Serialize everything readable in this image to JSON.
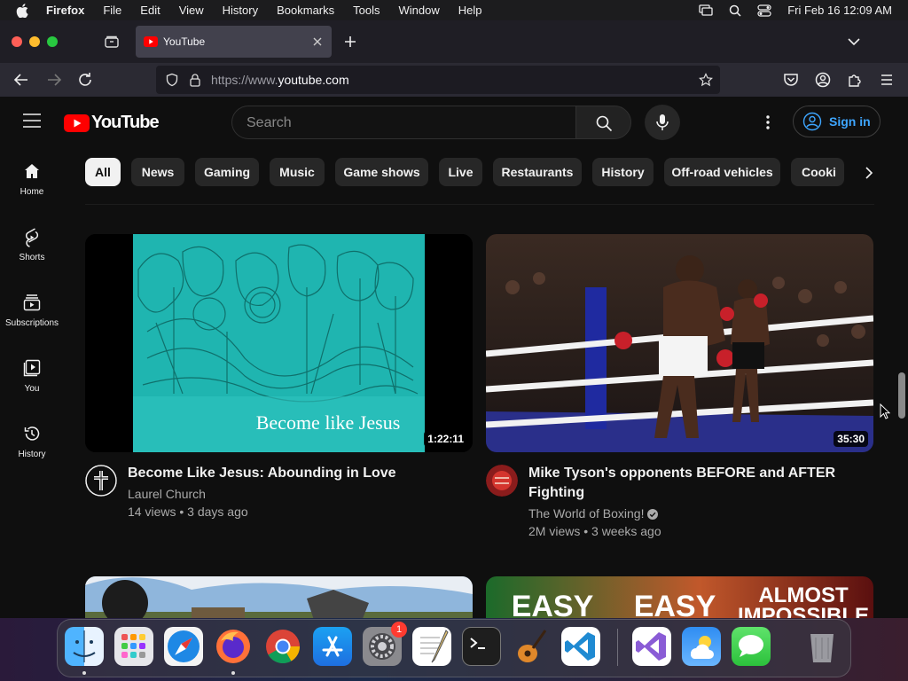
{
  "menubar": {
    "app_name": "Firefox",
    "menus": [
      "File",
      "Edit",
      "View",
      "History",
      "Bookmarks",
      "Tools",
      "Window",
      "Help"
    ],
    "clock": "Fri Feb 16  12:09 AM"
  },
  "browser": {
    "tab_title": "YouTube",
    "url_scheme": "https://www.",
    "url_host": "youtube.com"
  },
  "youtube": {
    "logo_text": "YouTube",
    "search_placeholder": "Search",
    "signin_label": "Sign in",
    "chips": [
      "All",
      "News",
      "Gaming",
      "Music",
      "Game shows",
      "Live",
      "Restaurants",
      "History",
      "Off-road vehicles",
      "Cooki"
    ],
    "active_chip": "All",
    "sidebar": [
      {
        "label": "Home",
        "icon": "home-icon"
      },
      {
        "label": "Shorts",
        "icon": "shorts-icon"
      },
      {
        "label": "Subscriptions",
        "icon": "subscriptions-icon"
      },
      {
        "label": "You",
        "icon": "you-icon"
      },
      {
        "label": "History",
        "icon": "history-icon"
      }
    ],
    "videos": [
      {
        "title": "Become Like Jesus: Abounding in Love",
        "channel": "Laurel Church",
        "stats": "14 views • 3 days ago",
        "duration": "1:22:11",
        "thumb_caption": "Become like Jesus",
        "verified": false
      },
      {
        "title": "Mike Tyson's opponents BEFORE and AFTER Fighting",
        "channel": "The World of Boxing!",
        "stats": "2M views • 3 weeks ago",
        "duration": "35:30",
        "verified": true
      }
    ],
    "next_row": {
      "thumb_text_1": "EASY",
      "thumb_text_2": "EASY",
      "thumb_text_3": "ALMOST",
      "thumb_text_4": "IMPOSSIBLE"
    }
  },
  "dock": {
    "apps": [
      "Finder",
      "Launchpad",
      "Safari",
      "Firefox",
      "Chrome",
      "App Store",
      "System Settings",
      "TextEdit",
      "Terminal",
      "GarageBand",
      "Visual Studio Code",
      "Visual Studio",
      "Weather",
      "Messages",
      "Trash"
    ],
    "settings_badge": "1"
  },
  "colors": {
    "youtube_red": "#ff0000",
    "link_blue": "#3ea6ff",
    "teal_thumb": "#1fb5b0"
  }
}
